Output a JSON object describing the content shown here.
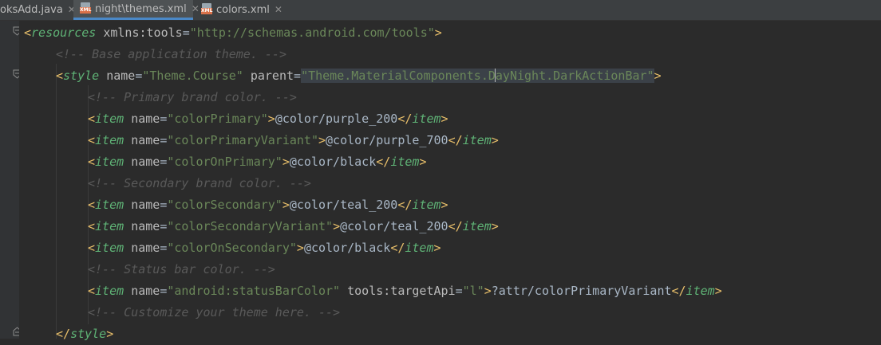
{
  "tabs": [
    {
      "label": "oksAdd.java",
      "active": false,
      "icon": null
    },
    {
      "label": "night\\themes.xml",
      "active": true,
      "icon": "xml-file-icon"
    },
    {
      "label": "colors.xml",
      "active": false,
      "icon": "xml-file-icon"
    }
  ],
  "close_glyph": "✕",
  "code": {
    "l1": {
      "lt": "<",
      "tag": "resources",
      "a1": "xmlns:tools",
      "eq": "=",
      "v1": "\"http://schemas.android.com/tools\"",
      "gt": ">"
    },
    "l2": {
      "comment": "<!-- Base application theme. -->"
    },
    "l3": {
      "lt": "<",
      "tag": "style",
      "a1": "name",
      "v1": "\"Theme.Course\"",
      "a2": "parent",
      "v2a": "\"Theme.MaterialComponents.D",
      "v2b": "ayNight.DarkActionBar\"",
      "gt": ">"
    },
    "l4": {
      "comment": "<!-- Primary brand color. -->"
    },
    "l5": {
      "tag": "item",
      "a1": "name",
      "v1": "\"colorPrimary\"",
      "text": "@color/purple_200"
    },
    "l6": {
      "tag": "item",
      "a1": "name",
      "v1": "\"colorPrimaryVariant\"",
      "text": "@color/purple_700"
    },
    "l7": {
      "tag": "item",
      "a1": "name",
      "v1": "\"colorOnPrimary\"",
      "text": "@color/black"
    },
    "l8": {
      "comment": "<!-- Secondary brand color. -->"
    },
    "l9": {
      "tag": "item",
      "a1": "name",
      "v1": "\"colorSecondary\"",
      "text": "@color/teal_200"
    },
    "l10": {
      "tag": "item",
      "a1": "name",
      "v1": "\"colorSecondaryVariant\"",
      "text": "@color/teal_200"
    },
    "l11": {
      "tag": "item",
      "a1": "name",
      "v1": "\"colorOnSecondary\"",
      "text": "@color/black"
    },
    "l12": {
      "comment": "<!-- Status bar color. -->"
    },
    "l13": {
      "tag": "item",
      "a1": "name",
      "v1": "\"android:statusBarColor\"",
      "a2": "tools:targetApi",
      "v2": "\"l\"",
      "text": "?attr/colorPrimaryVariant"
    },
    "l14": {
      "comment": "<!-- Customize your theme here. -->"
    },
    "l15": {
      "tag": "style"
    }
  },
  "colors": {
    "background": "#2b2b2b",
    "tag_bracket": "#e8bf6a",
    "tag_name": "#5fb376",
    "attribute": "#bababa",
    "attr_value": "#6a8759",
    "comment": "#808080",
    "active_tab_underline": "#4a88c7"
  }
}
